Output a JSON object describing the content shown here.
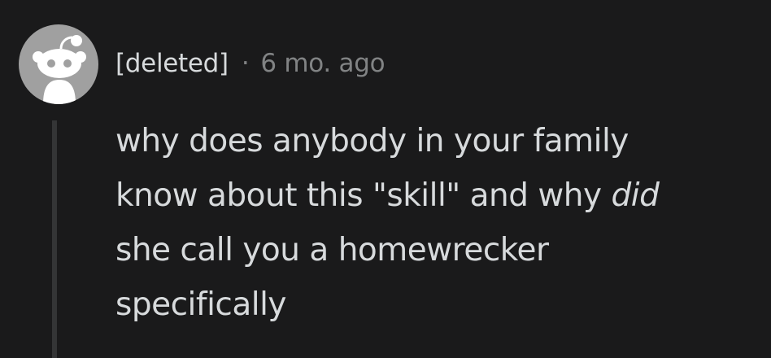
{
  "comment": {
    "author": "[deleted]",
    "separator": "·",
    "timestamp": "6 mo. ago",
    "avatar_icon": "reddit-snoo-icon",
    "body": {
      "line1": "why does anybody in your family",
      "line2_prefix": "know about this \"skill\" and why ",
      "line2_emphasis": "did",
      "line3": "she call you a homewrecker",
      "line4": "specifically"
    }
  },
  "colors": {
    "background": "#1a1a1b",
    "text": "#d7dadc",
    "meta_text": "#818384",
    "thread_line": "#343536",
    "avatar_bg": "#a0a0a0"
  }
}
